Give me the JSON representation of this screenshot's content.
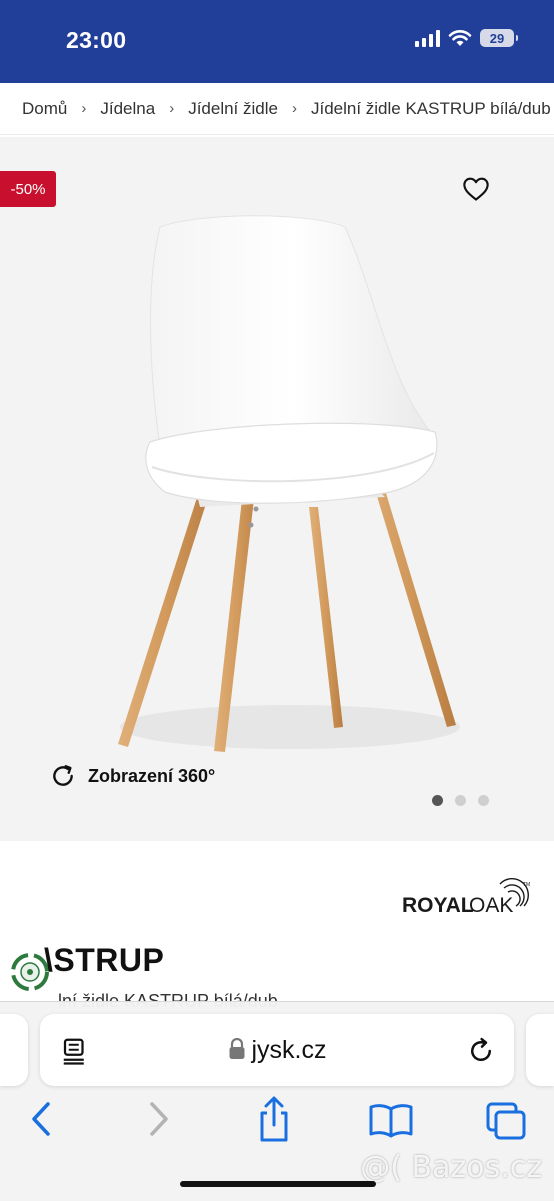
{
  "status_bar": {
    "time": "23:00",
    "battery": "29"
  },
  "breadcrumb": [
    "Domů",
    "Jídelna",
    "Jídelní židle",
    "Jídelní židle KASTRUP bílá/dub"
  ],
  "gallery": {
    "discount_badge": "-50%",
    "view360_label": "Zobrazení 360°",
    "image_count": 3,
    "active_image": 1
  },
  "brand_logo": {
    "left": "ROYAL",
    "right": "OAK",
    "tm": "TM"
  },
  "product": {
    "title": "\\STRUP",
    "subtitle": "lní židle KASTRUP bílá/dub"
  },
  "safari": {
    "url": "jysk.cz"
  },
  "watermark": "@( Bazos.cz",
  "colors": {
    "header_bg": "#213f99",
    "badge_bg": "#c8102e",
    "ios_blue": "#1a6fe0"
  },
  "icons": [
    "heart-icon",
    "rotate-360-icon",
    "reader-icon",
    "lock-icon",
    "reload-icon",
    "back-icon",
    "forward-icon",
    "share-icon",
    "bookmarks-icon",
    "tabs-icon"
  ]
}
